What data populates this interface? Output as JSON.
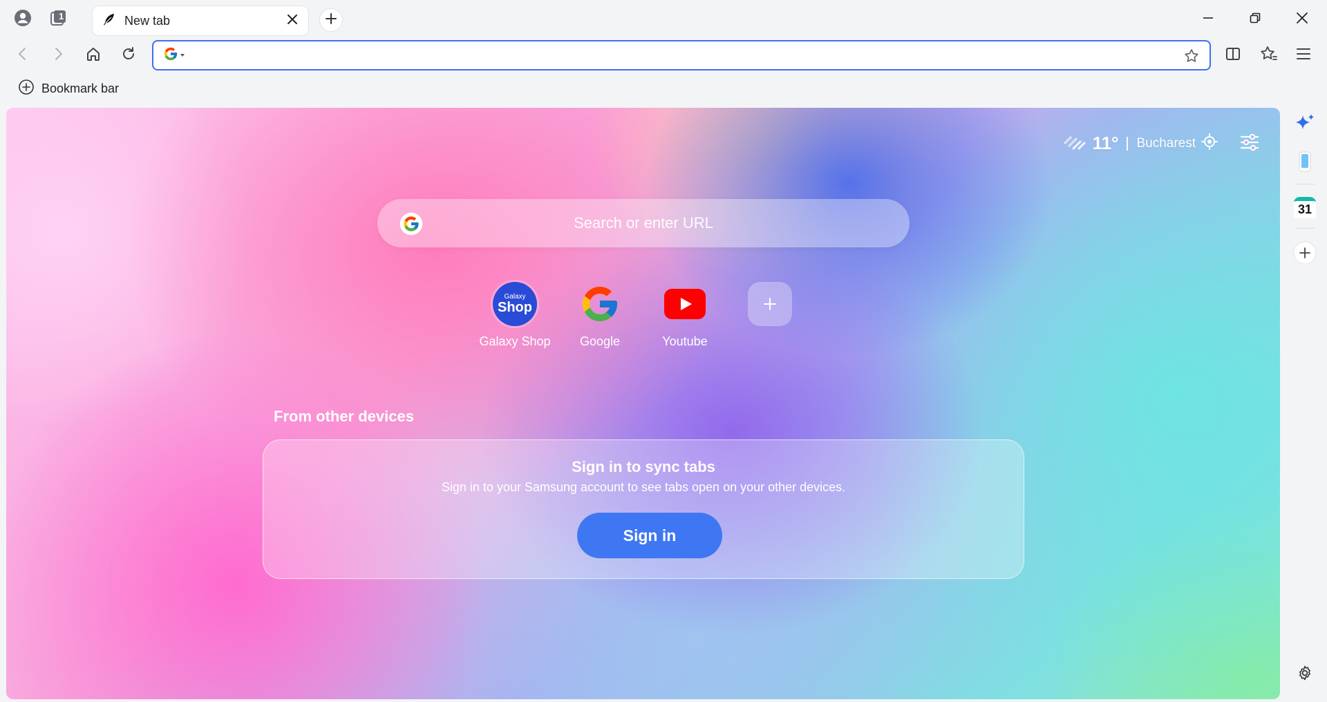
{
  "tabstrip": {
    "profile_icon": "profile-icon",
    "tab_counter": "1",
    "tabs": [
      {
        "title": "New tab",
        "icon": "feather-icon",
        "active": true
      }
    ],
    "new_tab_icon": "plus-icon",
    "window_controls": [
      "minimize-icon",
      "restore-icon",
      "close-icon"
    ]
  },
  "toolbar": {
    "nav_icons": [
      "back-arrow-icon",
      "forward-arrow-icon",
      "home-icon",
      "reload-icon"
    ],
    "address_value": "",
    "search_engine_icon": "google-g-icon",
    "right_icons": [
      "split-view-icon",
      "favorites-icon",
      "menu-icon"
    ]
  },
  "bookmark_bar": {
    "label": "Bookmark bar"
  },
  "newtab": {
    "weather": {
      "temperature": "11°",
      "city": "Bucharest"
    },
    "search": {
      "placeholder": "Search or enter URL"
    },
    "shortcuts": [
      {
        "label": "Galaxy Shop",
        "logo_top": "Galaxy",
        "logo_bottom": "Shop"
      },
      {
        "label": "Google"
      },
      {
        "label": "Youtube"
      }
    ],
    "from_other_devices": {
      "title": "From other devices",
      "card_title": "Sign in to sync tabs",
      "card_subtitle": "Sign in to your Samsung account to see tabs open on your other devices.",
      "button_label": "Sign in"
    }
  },
  "sidebar": {
    "calendar_day": "31",
    "icons": [
      "ai-sparkle-icon",
      "phone-icon",
      "calendar-icon",
      "add-icon",
      "settings-icon"
    ]
  },
  "colors": {
    "accent_blue": "#3f77f2",
    "omnibox_border": "#3d6ff0",
    "youtube_red": "#ff0000",
    "galaxy_shop_blue": "#2a4bd6"
  }
}
